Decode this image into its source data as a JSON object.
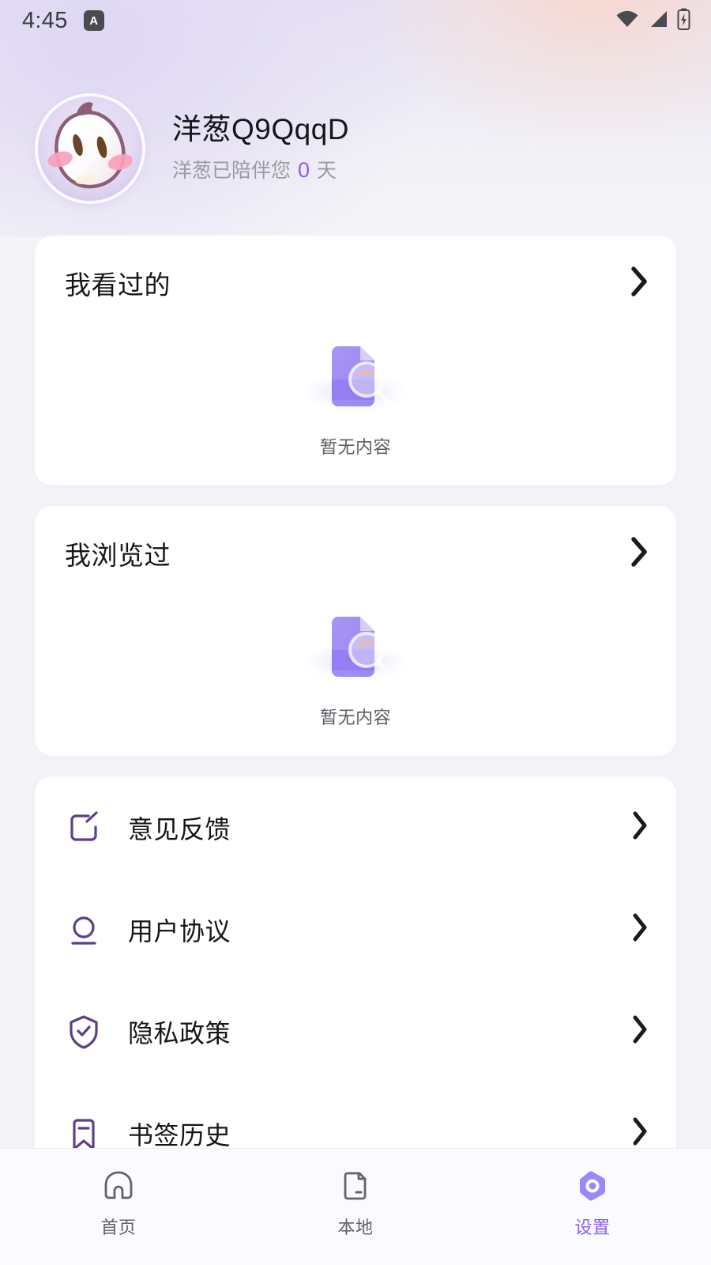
{
  "status_bar": {
    "time": "4:45",
    "app_badge_letter": "A",
    "icons": [
      "wifi-icon",
      "cellular-signal-icon",
      "battery-charging-icon"
    ]
  },
  "profile": {
    "avatar_name": "onion-mascot-avatar",
    "name": "洋葱Q9QqqD",
    "companion_prefix": "洋葱已陪伴您",
    "companion_days": "0",
    "companion_suffix": "天"
  },
  "cards": [
    {
      "title": "我看过的",
      "empty_text": "暂无内容",
      "chevron": "chevron-right-icon"
    },
    {
      "title": "我浏览过",
      "empty_text": "暂无内容",
      "chevron": "chevron-right-icon"
    }
  ],
  "menu": [
    {
      "label": "意见反馈",
      "icon": "feedback-edit-icon"
    },
    {
      "label": "用户协议",
      "icon": "user-agreement-icon"
    },
    {
      "label": "隐私政策",
      "icon": "shield-check-icon"
    },
    {
      "label": "书签历史",
      "icon": "bookmark-icon"
    }
  ],
  "bottom_nav": [
    {
      "label": "首页",
      "icon": "home-icon",
      "active": false
    },
    {
      "label": "本地",
      "icon": "folder-file-icon",
      "active": false
    },
    {
      "label": "设置",
      "icon": "settings-hexagon-icon",
      "active": true
    }
  ],
  "colors": {
    "accent": "#8b5cf6",
    "icon_purple": "#5b3f8c",
    "page_bg": "#f4f4f8",
    "card_bg": "#ffffff",
    "text_primary": "#16161a",
    "text_muted": "#9b9ba4"
  }
}
